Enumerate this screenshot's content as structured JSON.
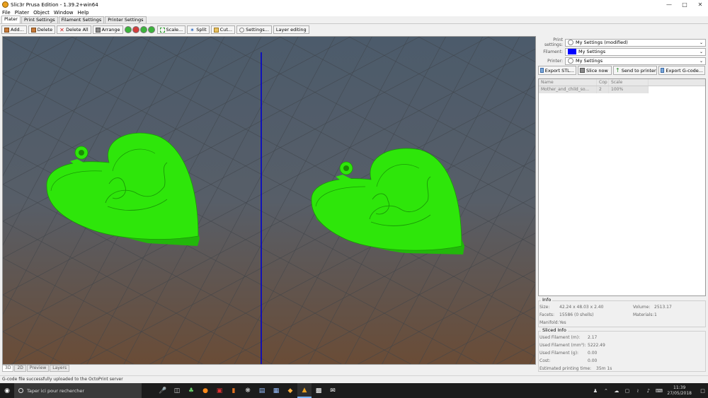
{
  "window": {
    "title": "Slic3r Prusa Edition - 1.39.2+win64"
  },
  "menu": [
    "File",
    "Plater",
    "Object",
    "Window",
    "Help"
  ],
  "tabs": [
    "Plater",
    "Print Settings",
    "Filament Settings",
    "Printer Settings"
  ],
  "toolbar": {
    "add": "Add...",
    "delete": "Delete",
    "delete_all": "Delete All",
    "arrange": "Arrange",
    "scale": "Scale...",
    "split": "Split",
    "cut": "Cut...",
    "settings": "Settings...",
    "layer_editing": "Layer editing"
  },
  "view_tabs": [
    "3D",
    "2D",
    "Preview",
    "Layers"
  ],
  "settings": {
    "print_label": "Print settings:",
    "print_value": "My Settings (modified)",
    "filament_label": "Filament:",
    "filament_value": "My Settings",
    "filament_color": "#0000ff",
    "printer_label": "Printer:",
    "printer_value": "My Settings"
  },
  "actions": {
    "export_stl": "Export STL...",
    "slice_now": "Slice now",
    "send_to_printer": "Send to printer",
    "export_gcode": "Export G-code..."
  },
  "object_list": {
    "headers": [
      "Name",
      "Cop",
      "Scale"
    ],
    "rows": [
      {
        "name": "Mother_and_child_so...",
        "copies": "2",
        "scale": "100%"
      }
    ]
  },
  "info": {
    "title": "Info",
    "size_label": "Size:",
    "size_value": "42.24 x 48.03 x 2.40",
    "volume_label": "Volume:",
    "volume_value": "2513.17",
    "facets_label": "Facets:",
    "facets_value": "15586 (0 shells)",
    "materials_label": "Materials:",
    "materials_value": "1",
    "manifold_label": "Manifold:",
    "manifold_value": "Yes"
  },
  "sliced_info": {
    "title": "Sliced Info",
    "rows": [
      {
        "label": "Used Filament (m):",
        "value": "2.17"
      },
      {
        "label": "Used Filament (mm³):",
        "value": "5222.49"
      },
      {
        "label": "Used Filament (g):",
        "value": "0.00"
      },
      {
        "label": "Cost:",
        "value": "0.00"
      },
      {
        "label": "Estimated printing time:",
        "value": "35m 1s"
      }
    ]
  },
  "status_text": "G-code file successfully uploaded to the OctoPrint server",
  "taskbar": {
    "search_placeholder": "Taper ici pour rechercher",
    "time": "11:39",
    "date": "27/05/2018"
  },
  "colors": {
    "model_green": "#2ee60a",
    "bed_line": "#0000cc"
  }
}
